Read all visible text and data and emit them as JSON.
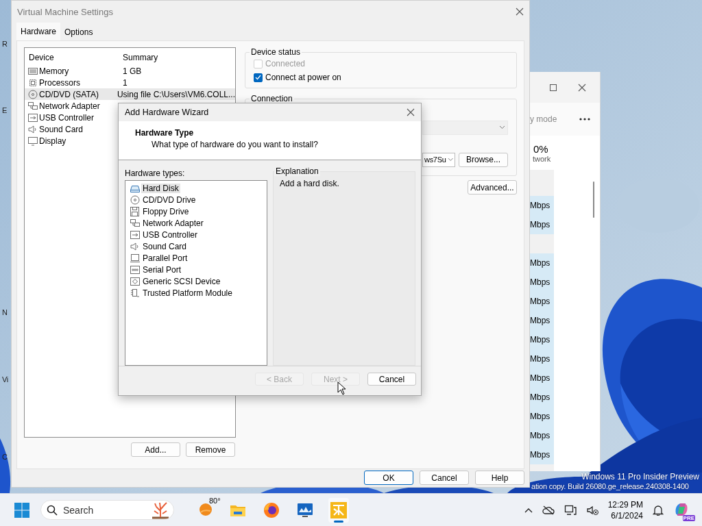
{
  "desktop": {
    "icon_labels": [
      "R",
      "E",
      "N",
      "Vi",
      "C"
    ],
    "watermark": [
      "Windows 11 Pro Insider Preview",
      "ation copy. Build 26080.ge_release.240308-1400"
    ]
  },
  "task_manager": {
    "mode_label": "y mode",
    "stat_value": "0%",
    "stat_label": "twork",
    "rows": [
      {
        "kind": "value",
        "text": "Mbps"
      },
      {
        "kind": "value",
        "text": "Mbps"
      },
      {
        "kind": "blank"
      },
      {
        "kind": "value",
        "text": "Mbps"
      },
      {
        "kind": "value",
        "text": "Mbps"
      },
      {
        "kind": "value",
        "text": "Mbps"
      },
      {
        "kind": "value",
        "text": "Mbps"
      },
      {
        "kind": "value",
        "text": "Mbps"
      },
      {
        "kind": "value",
        "text": "Mbps"
      },
      {
        "kind": "value",
        "text": "Mbps"
      },
      {
        "kind": "value",
        "text": "Mbps"
      },
      {
        "kind": "value",
        "text": "Mbps"
      },
      {
        "kind": "value",
        "text": "Mbps"
      },
      {
        "kind": "value",
        "text": "Mbps"
      }
    ]
  },
  "vm_settings": {
    "title": "Virtual Machine Settings",
    "tabs": [
      {
        "label": "Hardware",
        "selected": true
      },
      {
        "label": "Options",
        "selected": false
      }
    ],
    "device_list": {
      "columns": [
        "Device",
        "Summary"
      ],
      "rows": [
        {
          "kind": "memory",
          "device": "Memory",
          "summary": "1 GB",
          "selected": false
        },
        {
          "kind": "processor",
          "device": "Processors",
          "summary": "1",
          "selected": false
        },
        {
          "kind": "cd",
          "device": "CD/DVD (SATA)",
          "summary": "Using file C:\\Users\\VM6.COLL...",
          "selected": true
        },
        {
          "kind": "network",
          "device": "Network Adapter",
          "selected": false
        },
        {
          "kind": "usb",
          "device": "USB Controller",
          "selected": false
        },
        {
          "kind": "sound",
          "device": "Sound Card",
          "selected": false
        },
        {
          "kind": "display",
          "device": "Display",
          "selected": false
        }
      ]
    },
    "device_status": {
      "title": "Device status",
      "checkboxes": [
        {
          "label": "Connected",
          "checked": false,
          "disabled": true
        },
        {
          "label": "Connect at power on",
          "checked": true,
          "disabled": false
        }
      ]
    },
    "connection": {
      "title": "Connection",
      "dropdowns": [
        {
          "disabled": true
        },
        {
          "value": "ws7Su",
          "disabled": false
        }
      ],
      "browse_button": "Browse..."
    },
    "advanced_button": "Advanced...",
    "list_buttons": [
      "Add...",
      "Remove"
    ],
    "dialog_buttons": [
      {
        "label": "OK",
        "default": true
      },
      {
        "label": "Cancel",
        "default": false
      },
      {
        "label": "Help",
        "default": false
      }
    ]
  },
  "wizard": {
    "title": "Add Hardware Wizard",
    "heading": "Hardware Type",
    "subheading": "What type of hardware do you want to install?",
    "list_label": "Hardware types:",
    "hardware_types": [
      {
        "kind": "harddisk",
        "label": "Hard Disk",
        "selected": true
      },
      {
        "kind": "cd",
        "label": "CD/DVD Drive",
        "selected": false
      },
      {
        "kind": "floppy",
        "label": "Floppy Drive",
        "selected": false
      },
      {
        "kind": "network",
        "label": "Network Adapter",
        "selected": false
      },
      {
        "kind": "usb",
        "label": "USB Controller",
        "selected": false
      },
      {
        "kind": "sound",
        "label": "Sound Card",
        "selected": false
      },
      {
        "kind": "parallel",
        "label": "Parallel Port",
        "selected": false
      },
      {
        "kind": "serial",
        "label": "Serial Port",
        "selected": false
      },
      {
        "kind": "scsi",
        "label": "Generic SCSI Device",
        "selected": false
      },
      {
        "kind": "tpm",
        "label": "Trusted Platform Module",
        "selected": false
      }
    ],
    "explanation": {
      "title": "Explanation",
      "text": "Add a hard disk."
    },
    "buttons": [
      {
        "label": "< Back",
        "disabled": true
      },
      {
        "label": "Next >",
        "disabled": true
      },
      {
        "label": "Cancel",
        "disabled": false
      }
    ]
  },
  "taskbar": {
    "search_placeholder": "Search",
    "temperature": "80°",
    "apps": [
      {
        "kind": "explorer",
        "active": false
      },
      {
        "kind": "firefox",
        "active": false
      },
      {
        "kind": "monitor",
        "active": false
      },
      {
        "kind": "vmware",
        "active": true
      }
    ],
    "time": "12:29 PM",
    "date": "6/1/2024",
    "copilot_badge": "PRE"
  }
}
